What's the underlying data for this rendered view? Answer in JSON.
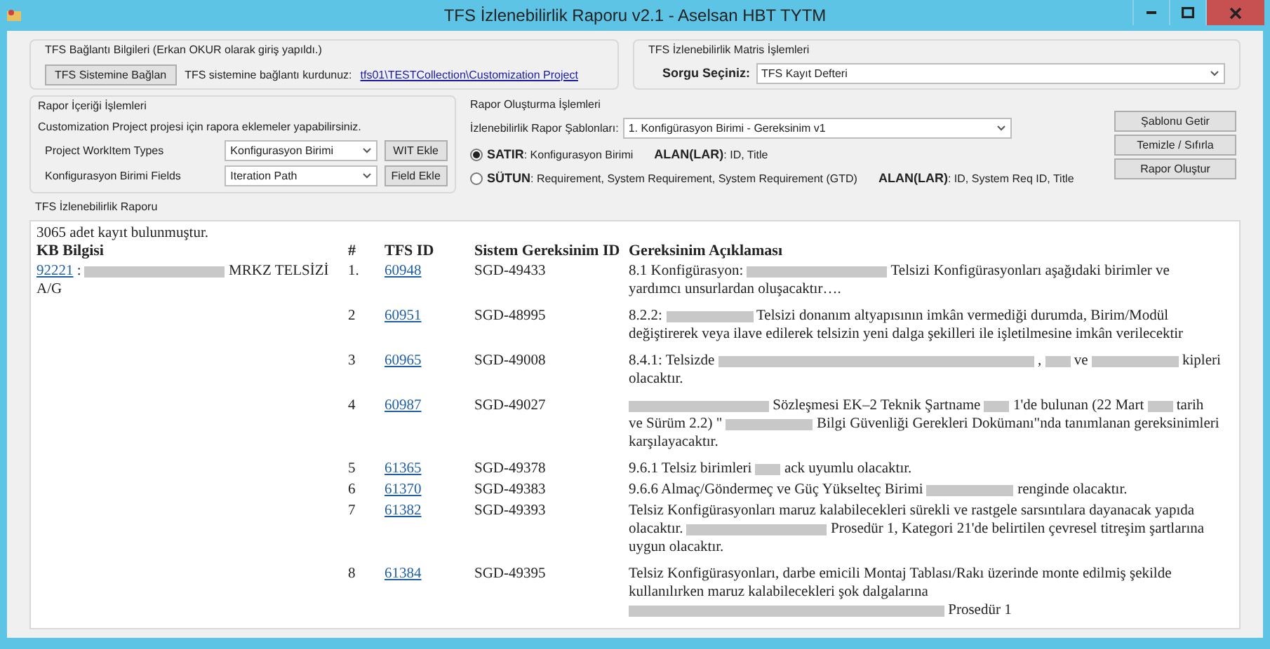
{
  "window": {
    "title": "TFS İzlenebilirlik Raporu v2.1 - Aselsan HBT TYTM"
  },
  "connection": {
    "title": "TFS Bağlantı Bilgileri (Erkan OKUR olarak giriş yapıldı.)",
    "button": "TFS Sistemine Bağlan",
    "status_label": "TFS sistemine bağlantı kurdunuz:",
    "link": "tfs01\\TESTCollection\\Customization Project"
  },
  "matrix": {
    "title": "TFS İzlenebilirlik Matris İşlemleri",
    "query_label": "Sorgu Seçiniz:",
    "query_value": "TFS Kayıt Defteri"
  },
  "content": {
    "title": "Rapor İçeriği İşlemleri",
    "hint": "Customization Project projesi için rapora eklemeler yapabilirsiniz.",
    "rows": [
      {
        "label": "Project WorkItem Types",
        "value": "Konfigurasyon Birimi",
        "button": "WIT Ekle"
      },
      {
        "label": "Konfigurasyon Birimi Fields",
        "value": "Iteration Path",
        "button": "Field Ekle"
      }
    ]
  },
  "creation": {
    "title": "Rapor Oluşturma İşlemleri",
    "template_label": "İzlenebilirlik Rapor Şablonları:",
    "template_value": "1. Konfigürasyon Birimi - Gereksinim v1",
    "options": [
      {
        "name": "SATIR",
        "types": ": Konfigurasyon Birimi",
        "fields_label": "ALAN(LAR)",
        "fields": ": ID, Title",
        "selected": true
      },
      {
        "name": "SÜTUN",
        "types": ": Requirement, System Requirement, System Requirement (GTD)",
        "fields_label": "ALAN(LAR)",
        "fields": ": ID, System Req ID, Title",
        "selected": false
      }
    ],
    "buttons": [
      "Şablonu Getir",
      "Temizle / Sıfırla",
      "Rapor Oluştur"
    ]
  },
  "report": {
    "title": "TFS İzlenebilirlik Raporu",
    "count": "3065 adet kayıt bulunmuştur.",
    "columns": [
      "KB Bilgisi",
      "#",
      "TFS ID",
      "Sistem Gereksinim ID",
      "Gereksinim Açıklaması"
    ],
    "kb": [
      {
        "kind": "link",
        "text": "92221"
      },
      {
        "kind": "text",
        "text": ":"
      },
      {
        "kind": "bar"
      },
      {
        "kind": "text",
        "text": "MRKZ TELSİZİ A/G"
      }
    ],
    "rows": [
      {
        "number": "1.",
        "tfs_id": "60948",
        "req_id": "SGD-49433",
        "description": [
          {
            "kind": "text",
            "text": "8.1 Konfigürasyon:"
          },
          {
            "kind": "bar"
          },
          {
            "kind": "text",
            "text": "Telsizi Konfigürasyonları aşağıdaki birimler ve yardımcı unsurlardan oluşacaktır…."
          }
        ]
      },
      {
        "number": "2",
        "tfs_id": "60951",
        "req_id": "SGD-48995",
        "description": [
          {
            "kind": "text",
            "text": "8.2.2:"
          },
          {
            "kind": "redaction"
          },
          {
            "kind": "text",
            "text": "Telsizi donanım altyapısının imkân vermediği durumda, Birim/Modül değiştirerek veya ilave edilerek telsizin yeni dalga şekilleri ile işletilmesine imkân verilecektir"
          }
        ]
      },
      {
        "number": "3",
        "tfs_id": "60965",
        "req_id": "SGD-49008",
        "description": [
          {
            "kind": "text",
            "text": "8.4.1: Telsizde"
          },
          {
            "kind": "strip"
          },
          {
            "kind": "text",
            "text": ","
          },
          {
            "kind": "blank"
          },
          {
            "kind": "text",
            "text": "ve"
          },
          {
            "kind": "redaction"
          },
          {
            "kind": "text",
            "text": "kipleri olacaktır."
          }
        ]
      },
      {
        "number": "4",
        "tfs_id": "60987",
        "req_id": "SGD-49027",
        "description": [
          {
            "kind": "bar"
          },
          {
            "kind": "text",
            "text": "Sözleşmesi EK–2 Teknik Şartname"
          },
          {
            "kind": "blank"
          },
          {
            "kind": "text",
            "text": "1'de bulunan (22 Mart"
          },
          {
            "kind": "blank"
          },
          {
            "kind": "text",
            "text": "tarih ve Sürüm 2.2) \""
          },
          {
            "kind": "redaction"
          },
          {
            "kind": "text",
            "text": "Bilgi Güvenliği Gerekleri Dokümanı\"nda tanımlanan gereksinimleri karşılayacaktır."
          }
        ]
      },
      {
        "number": "5",
        "tfs_id": "61365",
        "req_id": "SGD-49378",
        "description": [
          {
            "kind": "text",
            "text": "9.6.1 Telsiz birimleri"
          },
          {
            "kind": "blank"
          },
          {
            "kind": "text",
            "text": "ack uyumlu olacaktır."
          }
        ]
      },
      {
        "number": "6",
        "tfs_id": "61370",
        "req_id": "SGD-49383",
        "description": [
          {
            "kind": "text",
            "text": "9.6.6 Almaç/Göndermeç ve Güç Yükselteç Birimi"
          },
          {
            "kind": "redaction"
          },
          {
            "kind": "text",
            "text": "renginde olacaktır."
          }
        ]
      },
      {
        "number": "7",
        "tfs_id": "61382",
        "req_id": "SGD-49393",
        "description": [
          {
            "kind": "text",
            "text": "Telsiz Konfigürasyonları maruz kalabilecekleri sürekli ve rastgele sarsıntılara dayanacak yapıda olacaktır."
          },
          {
            "kind": "bar"
          },
          {
            "kind": "text",
            "text": "Prosedür 1, Kategori 21'de belirtilen çevresel titreşim şartlarına uygun olacaktır."
          }
        ]
      },
      {
        "number": "8",
        "tfs_id": "61384",
        "req_id": "SGD-49395",
        "description": [
          {
            "kind": "text",
            "text": "Telsiz Konfigürasyonları, darbe emicili Montaj Tablası/Rakı üzerinde monte edilmiş şekilde kullanılırken maruz kalabilecekleri şok dalgalarına"
          },
          {
            "kind": "strip"
          },
          {
            "kind": "text",
            "text": "Prosedür 1"
          }
        ]
      }
    ]
  }
}
